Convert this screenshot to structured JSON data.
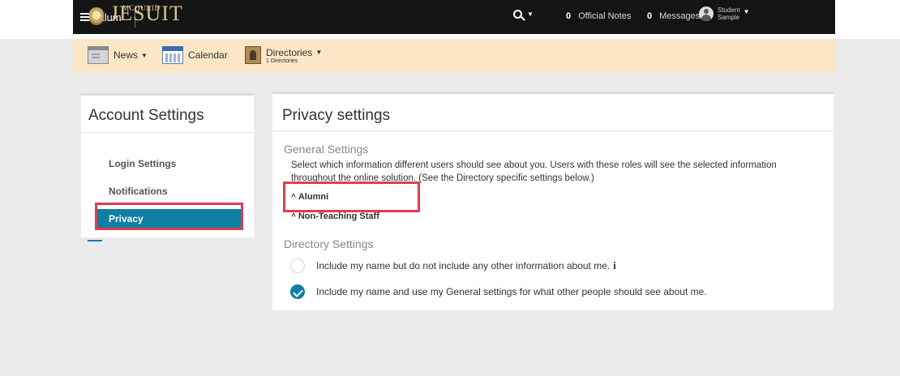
{
  "topbar": {
    "menu_label": "Alum",
    "logo_text": "JESUIT",
    "logo_small": "MCQUAID",
    "official_notes_count": "0",
    "official_notes_label": "Official Notes",
    "messages_count": "0",
    "messages_label": "Messages",
    "user_line1": "Student",
    "user_line2": "Sample"
  },
  "subnav": {
    "news_label": "News",
    "calendar_label": "Calendar",
    "directories_label": "Directories",
    "directories_sub": "1 Directories"
  },
  "account_panel": {
    "title": "Account Settings",
    "items": [
      {
        "label": "Login Settings"
      },
      {
        "label": "Notifications"
      },
      {
        "label": "Privacy",
        "active": true
      }
    ]
  },
  "privacy_panel": {
    "title": "Privacy settings",
    "general_heading": "General Settings",
    "general_description": "Select which information different users should see about you. Users with these roles will see the selected information throughout the online solution. (See the Directory specific settings below.)",
    "roles": [
      {
        "label": "Alumni"
      },
      {
        "label": "Non-Teaching Staff"
      }
    ],
    "directory_heading": "Directory Settings",
    "options": [
      {
        "label": "Include my name but do not include any other information about me.",
        "checked": false
      },
      {
        "label": "Include my name and use my General settings for what other people should see about me.",
        "checked": true
      }
    ]
  },
  "colors": {
    "accent": "#0f7ea2",
    "highlight": "#dc3f4e",
    "topbar": "#141414",
    "subnav": "#fbe7c6"
  }
}
